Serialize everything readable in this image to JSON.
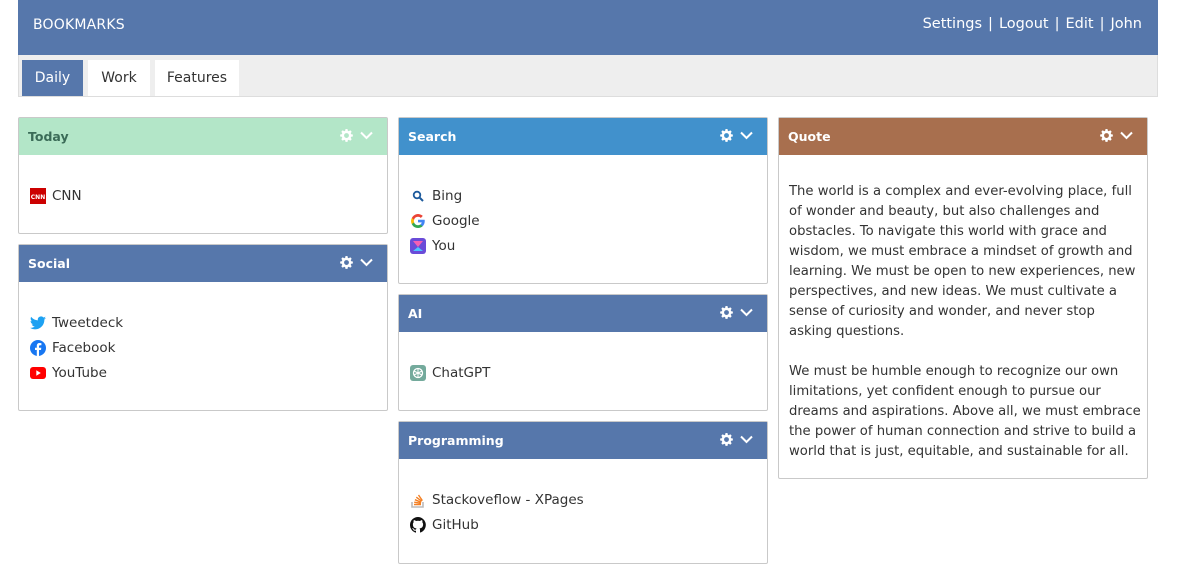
{
  "header": {
    "brand": "BOOKMARKS",
    "nav": {
      "settings": "Settings",
      "logout": "Logout",
      "edit": "Edit",
      "user": "John",
      "separator": "|"
    }
  },
  "tabs": [
    {
      "label": "Daily",
      "active": true
    },
    {
      "label": "Work",
      "active": false
    },
    {
      "label": "Features",
      "active": false
    }
  ],
  "panels": {
    "today": {
      "title": "Today",
      "color": "#b3e6c8",
      "title_color": "#3a6b57",
      "links": [
        {
          "label": "CNN",
          "icon": "cnn-icon"
        }
      ]
    },
    "social": {
      "title": "Social",
      "color": "#5677ab",
      "links": [
        {
          "label": "Tweetdeck",
          "icon": "twitter-icon"
        },
        {
          "label": "Facebook",
          "icon": "facebook-icon"
        },
        {
          "label": "YouTube",
          "icon": "youtube-icon"
        }
      ]
    },
    "search": {
      "title": "Search",
      "color": "#4191cc",
      "links": [
        {
          "label": "Bing",
          "icon": "bing-search-icon"
        },
        {
          "label": "Google",
          "icon": "google-icon"
        },
        {
          "label": "You",
          "icon": "you-icon"
        }
      ]
    },
    "ai": {
      "title": "AI",
      "color": "#5677ab",
      "links": [
        {
          "label": "ChatGPT",
          "icon": "chatgpt-icon"
        }
      ]
    },
    "programming": {
      "title": "Programming",
      "color": "#5677ab",
      "links": [
        {
          "label": "Stackoveflow - XPages",
          "icon": "stackoverflow-icon"
        },
        {
          "label": "GitHub",
          "icon": "github-icon"
        }
      ]
    },
    "quote": {
      "title": "Quote",
      "color": "#a86f4e",
      "paragraphs": [
        "The world is a complex and ever-evolving place, full of wonder and beauty, but also challenges and obstacles. To navigate this world with grace and wisdom, we must embrace a mindset of growth and learning. We must be open to new experiences, new perspectives, and new ideas. We must cultivate a sense of curiosity and wonder, and never stop asking questions.",
        "We must be humble enough to recognize our own limitations, yet confident enough to pursue our dreams and aspirations. Above all, we must embrace the power of human connection and strive to build a world that is just, equitable, and sustainable for all."
      ]
    }
  }
}
